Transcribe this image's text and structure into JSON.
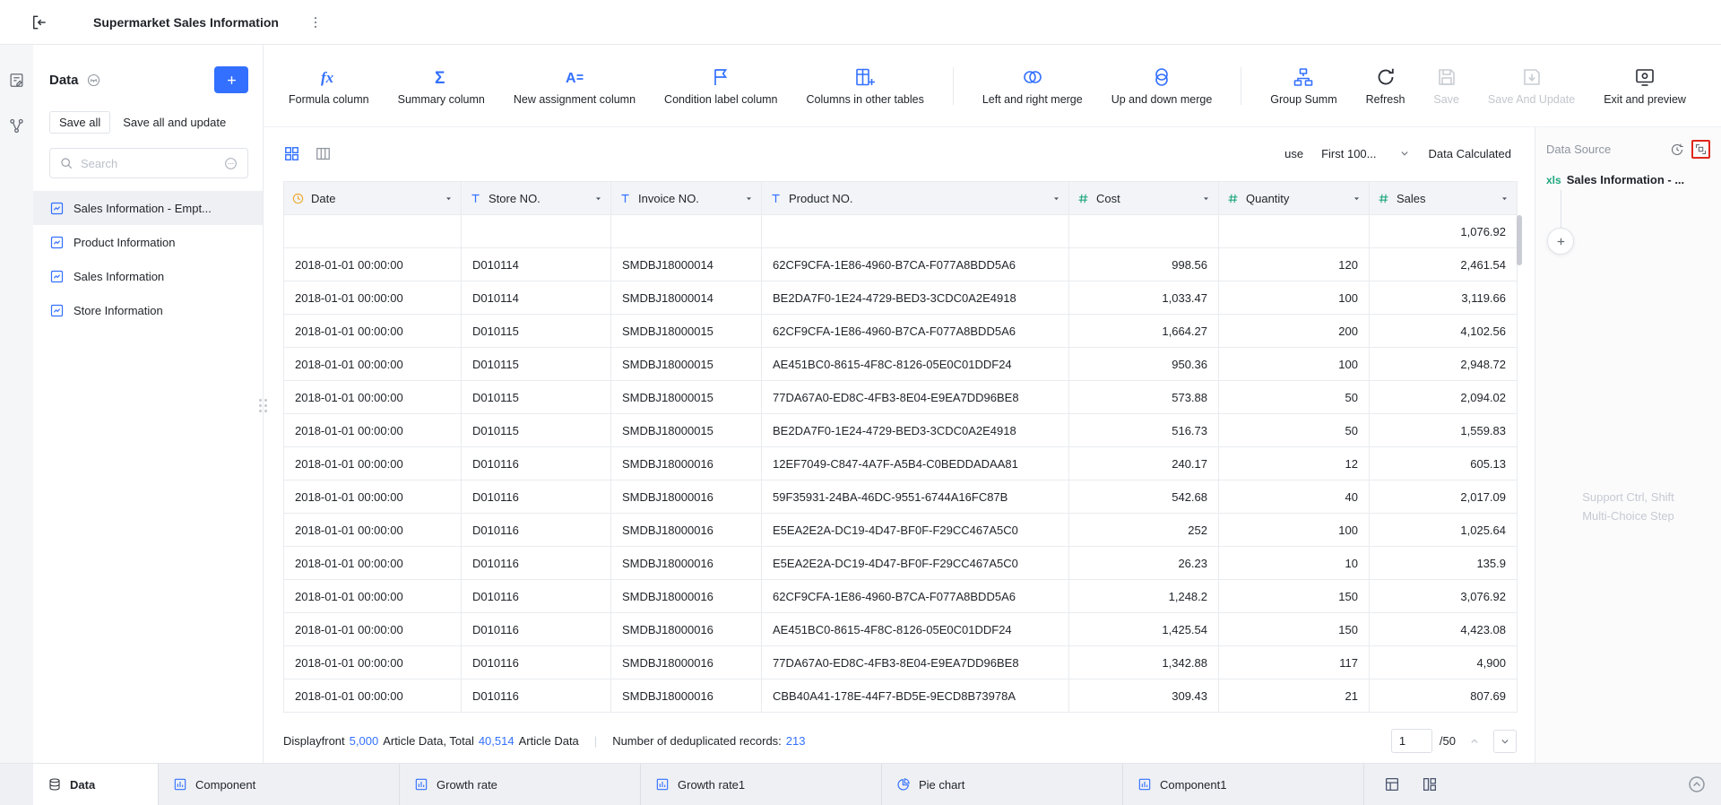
{
  "app": {
    "title": "Supermarket Sales Information"
  },
  "sidebar": {
    "heading": "Data",
    "save_all": "Save all",
    "save_all_and_update": "Save all and update",
    "search_placeholder": "Search",
    "items": [
      {
        "label": "Sales Information - Empt...",
        "selected": true
      },
      {
        "label": "Product Information",
        "selected": false
      },
      {
        "label": "Sales Information",
        "selected": false
      },
      {
        "label": "Store Information",
        "selected": false
      }
    ]
  },
  "toolbar": {
    "items": [
      {
        "icon": "formula-icon",
        "label": "Formula column",
        "state": "enabled"
      },
      {
        "icon": "summary-icon",
        "label": "Summary column",
        "state": "enabled"
      },
      {
        "icon": "assignment-icon",
        "label": "New assignment column",
        "state": "enabled"
      },
      {
        "icon": "condition-icon",
        "label": "Condition label column",
        "state": "enabled"
      },
      {
        "icon": "other-tables-icon",
        "label": "Columns in other tables",
        "state": "enabled"
      },
      {
        "type": "divider"
      },
      {
        "icon": "lr-merge-icon",
        "label": "Left and right merge",
        "state": "enabled"
      },
      {
        "icon": "ud-merge-icon",
        "label": "Up and down merge",
        "state": "enabled"
      },
      {
        "type": "divider"
      },
      {
        "icon": "group-icon",
        "label": "Group Summ",
        "state": "enabled"
      },
      {
        "icon": "refresh-icon",
        "label": "Refresh",
        "state": "neutral"
      },
      {
        "icon": "save-icon",
        "label": "Save",
        "state": "disabled"
      },
      {
        "icon": "save-update-icon",
        "label": "Save And Update",
        "state": "disabled"
      },
      {
        "icon": "exit-preview-icon",
        "label": "Exit and preview",
        "state": "neutral"
      }
    ]
  },
  "view_bar": {
    "use_label": "use",
    "limit_value": "First 100...",
    "status": "Data Calculated"
  },
  "table": {
    "columns": [
      {
        "label": "Date",
        "type": "date",
        "icon": "clock-icon"
      },
      {
        "label": "Store NO.",
        "type": "text",
        "icon": "text-icon"
      },
      {
        "label": "Invoice NO.",
        "type": "text",
        "icon": "text-icon"
      },
      {
        "label": "Product NO.",
        "type": "text",
        "icon": "text-icon"
      },
      {
        "label": "Cost",
        "type": "number",
        "icon": "hash-icon"
      },
      {
        "label": "Quantity",
        "type": "number",
        "icon": "hash-icon"
      },
      {
        "label": "Sales",
        "type": "number",
        "icon": "hash-icon"
      }
    ],
    "rows": [
      [
        "",
        "",
        "",
        "",
        "",
        "",
        "1,076.92"
      ],
      [
        "2018-01-01 00:00:00",
        "D010114",
        "SMDBJ18000014",
        "62CF9CFA-1E86-4960-B7CA-F077A8BDD5A6",
        "998.56",
        "120",
        "2,461.54"
      ],
      [
        "2018-01-01 00:00:00",
        "D010114",
        "SMDBJ18000014",
        "BE2DA7F0-1E24-4729-BED3-3CDC0A2E4918",
        "1,033.47",
        "100",
        "3,119.66"
      ],
      [
        "2018-01-01 00:00:00",
        "D010115",
        "SMDBJ18000015",
        "62CF9CFA-1E86-4960-B7CA-F077A8BDD5A6",
        "1,664.27",
        "200",
        "4,102.56"
      ],
      [
        "2018-01-01 00:00:00",
        "D010115",
        "SMDBJ18000015",
        "AE451BC0-8615-4F8C-8126-05E0C01DDF24",
        "950.36",
        "100",
        "2,948.72"
      ],
      [
        "2018-01-01 00:00:00",
        "D010115",
        "SMDBJ18000015",
        "77DA67A0-ED8C-4FB3-8E04-E9EA7DD96BE8",
        "573.88",
        "50",
        "2,094.02"
      ],
      [
        "2018-01-01 00:00:00",
        "D010115",
        "SMDBJ18000015",
        "BE2DA7F0-1E24-4729-BED3-3CDC0A2E4918",
        "516.73",
        "50",
        "1,559.83"
      ],
      [
        "2018-01-01 00:00:00",
        "D010116",
        "SMDBJ18000016",
        "12EF7049-C847-4A7F-A5B4-C0BEDDADAA81",
        "240.17",
        "12",
        "605.13"
      ],
      [
        "2018-01-01 00:00:00",
        "D010116",
        "SMDBJ18000016",
        "59F35931-24BA-46DC-9551-6744A16FC87B",
        "542.68",
        "40",
        "2,017.09"
      ],
      [
        "2018-01-01 00:00:00",
        "D010116",
        "SMDBJ18000016",
        "E5EA2E2A-DC19-4D47-BF0F-F29CC467A5C0",
        "252",
        "100",
        "1,025.64"
      ],
      [
        "2018-01-01 00:00:00",
        "D010116",
        "SMDBJ18000016",
        "E5EA2E2A-DC19-4D47-BF0F-F29CC467A5C0",
        "26.23",
        "10",
        "135.9"
      ],
      [
        "2018-01-01 00:00:00",
        "D010116",
        "SMDBJ18000016",
        "62CF9CFA-1E86-4960-B7CA-F077A8BDD5A6",
        "1,248.2",
        "150",
        "3,076.92"
      ],
      [
        "2018-01-01 00:00:00",
        "D010116",
        "SMDBJ18000016",
        "AE451BC0-8615-4F8C-8126-05E0C01DDF24",
        "1,425.54",
        "150",
        "4,423.08"
      ],
      [
        "2018-01-01 00:00:00",
        "D010116",
        "SMDBJ18000016",
        "77DA67A0-ED8C-4FB3-8E04-E9EA7DD96BE8",
        "1,342.88",
        "117",
        "4,900"
      ],
      [
        "2018-01-01 00:00:00",
        "D010116",
        "SMDBJ18000016",
        "CBB40A41-178E-44F7-BD5E-9ECD8B73978A",
        "309.43",
        "21",
        "807.69"
      ]
    ]
  },
  "footer": {
    "display_prefix": "Displayfront",
    "display_count": "5,000",
    "display_mid": "Article Data, Total",
    "total_count": "40,514",
    "display_suffix": "Article Data",
    "dedup_label": "Number of deduplicated records:",
    "dedup_count": "213",
    "page_value": "1",
    "page_total": "/50"
  },
  "data_source": {
    "title": "Data Source",
    "file_type": "xls",
    "file_name": "Sales Information - ...",
    "hint_line1": "Support Ctrl, Shift",
    "hint_line2": "Multi-Choice Step"
  },
  "bottom_tabs": {
    "items": [
      {
        "label": "Data",
        "icon": "db-icon",
        "selected": true
      },
      {
        "label": "Component",
        "icon": "chart-icon",
        "selected": false
      },
      {
        "label": "Growth rate",
        "icon": "chart-icon",
        "selected": false
      },
      {
        "label": "Growth rate1",
        "icon": "chart-icon",
        "selected": false
      },
      {
        "label": "Pie chart",
        "icon": "pie-icon",
        "selected": false
      },
      {
        "label": "Component1",
        "icon": "chart-icon",
        "selected": false
      }
    ]
  },
  "colors": {
    "accent_blue": "#3370ff",
    "number_green": "#1fa77c",
    "date_orange": "#f0a62a",
    "annotation_red": "#e0281e"
  }
}
